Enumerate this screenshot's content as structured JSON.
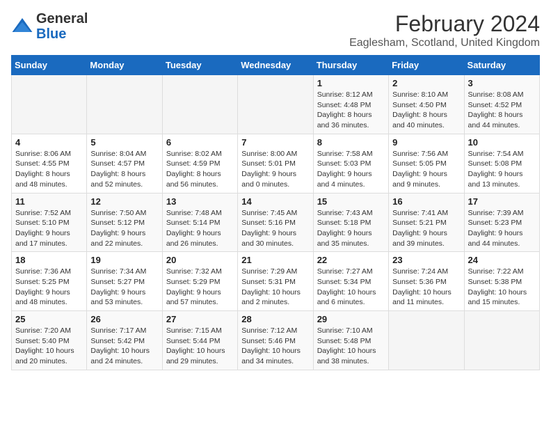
{
  "header": {
    "logo_general": "General",
    "logo_blue": "Blue",
    "title": "February 2024",
    "subtitle": "Eaglesham, Scotland, United Kingdom"
  },
  "weekdays": [
    "Sunday",
    "Monday",
    "Tuesday",
    "Wednesday",
    "Thursday",
    "Friday",
    "Saturday"
  ],
  "weeks": [
    [
      {
        "day": "",
        "sunrise": "",
        "sunset": "",
        "daylight": ""
      },
      {
        "day": "",
        "sunrise": "",
        "sunset": "",
        "daylight": ""
      },
      {
        "day": "",
        "sunrise": "",
        "sunset": "",
        "daylight": ""
      },
      {
        "day": "",
        "sunrise": "",
        "sunset": "",
        "daylight": ""
      },
      {
        "day": "1",
        "sunrise": "Sunrise: 8:12 AM",
        "sunset": "Sunset: 4:48 PM",
        "daylight": "Daylight: 8 hours and 36 minutes."
      },
      {
        "day": "2",
        "sunrise": "Sunrise: 8:10 AM",
        "sunset": "Sunset: 4:50 PM",
        "daylight": "Daylight: 8 hours and 40 minutes."
      },
      {
        "day": "3",
        "sunrise": "Sunrise: 8:08 AM",
        "sunset": "Sunset: 4:52 PM",
        "daylight": "Daylight: 8 hours and 44 minutes."
      }
    ],
    [
      {
        "day": "4",
        "sunrise": "Sunrise: 8:06 AM",
        "sunset": "Sunset: 4:55 PM",
        "daylight": "Daylight: 8 hours and 48 minutes."
      },
      {
        "day": "5",
        "sunrise": "Sunrise: 8:04 AM",
        "sunset": "Sunset: 4:57 PM",
        "daylight": "Daylight: 8 hours and 52 minutes."
      },
      {
        "day": "6",
        "sunrise": "Sunrise: 8:02 AM",
        "sunset": "Sunset: 4:59 PM",
        "daylight": "Daylight: 8 hours and 56 minutes."
      },
      {
        "day": "7",
        "sunrise": "Sunrise: 8:00 AM",
        "sunset": "Sunset: 5:01 PM",
        "daylight": "Daylight: 9 hours and 0 minutes."
      },
      {
        "day": "8",
        "sunrise": "Sunrise: 7:58 AM",
        "sunset": "Sunset: 5:03 PM",
        "daylight": "Daylight: 9 hours and 4 minutes."
      },
      {
        "day": "9",
        "sunrise": "Sunrise: 7:56 AM",
        "sunset": "Sunset: 5:05 PM",
        "daylight": "Daylight: 9 hours and 9 minutes."
      },
      {
        "day": "10",
        "sunrise": "Sunrise: 7:54 AM",
        "sunset": "Sunset: 5:08 PM",
        "daylight": "Daylight: 9 hours and 13 minutes."
      }
    ],
    [
      {
        "day": "11",
        "sunrise": "Sunrise: 7:52 AM",
        "sunset": "Sunset: 5:10 PM",
        "daylight": "Daylight: 9 hours and 17 minutes."
      },
      {
        "day": "12",
        "sunrise": "Sunrise: 7:50 AM",
        "sunset": "Sunset: 5:12 PM",
        "daylight": "Daylight: 9 hours and 22 minutes."
      },
      {
        "day": "13",
        "sunrise": "Sunrise: 7:48 AM",
        "sunset": "Sunset: 5:14 PM",
        "daylight": "Daylight: 9 hours and 26 minutes."
      },
      {
        "day": "14",
        "sunrise": "Sunrise: 7:45 AM",
        "sunset": "Sunset: 5:16 PM",
        "daylight": "Daylight: 9 hours and 30 minutes."
      },
      {
        "day": "15",
        "sunrise": "Sunrise: 7:43 AM",
        "sunset": "Sunset: 5:18 PM",
        "daylight": "Daylight: 9 hours and 35 minutes."
      },
      {
        "day": "16",
        "sunrise": "Sunrise: 7:41 AM",
        "sunset": "Sunset: 5:21 PM",
        "daylight": "Daylight: 9 hours and 39 minutes."
      },
      {
        "day": "17",
        "sunrise": "Sunrise: 7:39 AM",
        "sunset": "Sunset: 5:23 PM",
        "daylight": "Daylight: 9 hours and 44 minutes."
      }
    ],
    [
      {
        "day": "18",
        "sunrise": "Sunrise: 7:36 AM",
        "sunset": "Sunset: 5:25 PM",
        "daylight": "Daylight: 9 hours and 48 minutes."
      },
      {
        "day": "19",
        "sunrise": "Sunrise: 7:34 AM",
        "sunset": "Sunset: 5:27 PM",
        "daylight": "Daylight: 9 hours and 53 minutes."
      },
      {
        "day": "20",
        "sunrise": "Sunrise: 7:32 AM",
        "sunset": "Sunset: 5:29 PM",
        "daylight": "Daylight: 9 hours and 57 minutes."
      },
      {
        "day": "21",
        "sunrise": "Sunrise: 7:29 AM",
        "sunset": "Sunset: 5:31 PM",
        "daylight": "Daylight: 10 hours and 2 minutes."
      },
      {
        "day": "22",
        "sunrise": "Sunrise: 7:27 AM",
        "sunset": "Sunset: 5:34 PM",
        "daylight": "Daylight: 10 hours and 6 minutes."
      },
      {
        "day": "23",
        "sunrise": "Sunrise: 7:24 AM",
        "sunset": "Sunset: 5:36 PM",
        "daylight": "Daylight: 10 hours and 11 minutes."
      },
      {
        "day": "24",
        "sunrise": "Sunrise: 7:22 AM",
        "sunset": "Sunset: 5:38 PM",
        "daylight": "Daylight: 10 hours and 15 minutes."
      }
    ],
    [
      {
        "day": "25",
        "sunrise": "Sunrise: 7:20 AM",
        "sunset": "Sunset: 5:40 PM",
        "daylight": "Daylight: 10 hours and 20 minutes."
      },
      {
        "day": "26",
        "sunrise": "Sunrise: 7:17 AM",
        "sunset": "Sunset: 5:42 PM",
        "daylight": "Daylight: 10 hours and 24 minutes."
      },
      {
        "day": "27",
        "sunrise": "Sunrise: 7:15 AM",
        "sunset": "Sunset: 5:44 PM",
        "daylight": "Daylight: 10 hours and 29 minutes."
      },
      {
        "day": "28",
        "sunrise": "Sunrise: 7:12 AM",
        "sunset": "Sunset: 5:46 PM",
        "daylight": "Daylight: 10 hours and 34 minutes."
      },
      {
        "day": "29",
        "sunrise": "Sunrise: 7:10 AM",
        "sunset": "Sunset: 5:48 PM",
        "daylight": "Daylight: 10 hours and 38 minutes."
      },
      {
        "day": "",
        "sunrise": "",
        "sunset": "",
        "daylight": ""
      },
      {
        "day": "",
        "sunrise": "",
        "sunset": "",
        "daylight": ""
      }
    ]
  ]
}
